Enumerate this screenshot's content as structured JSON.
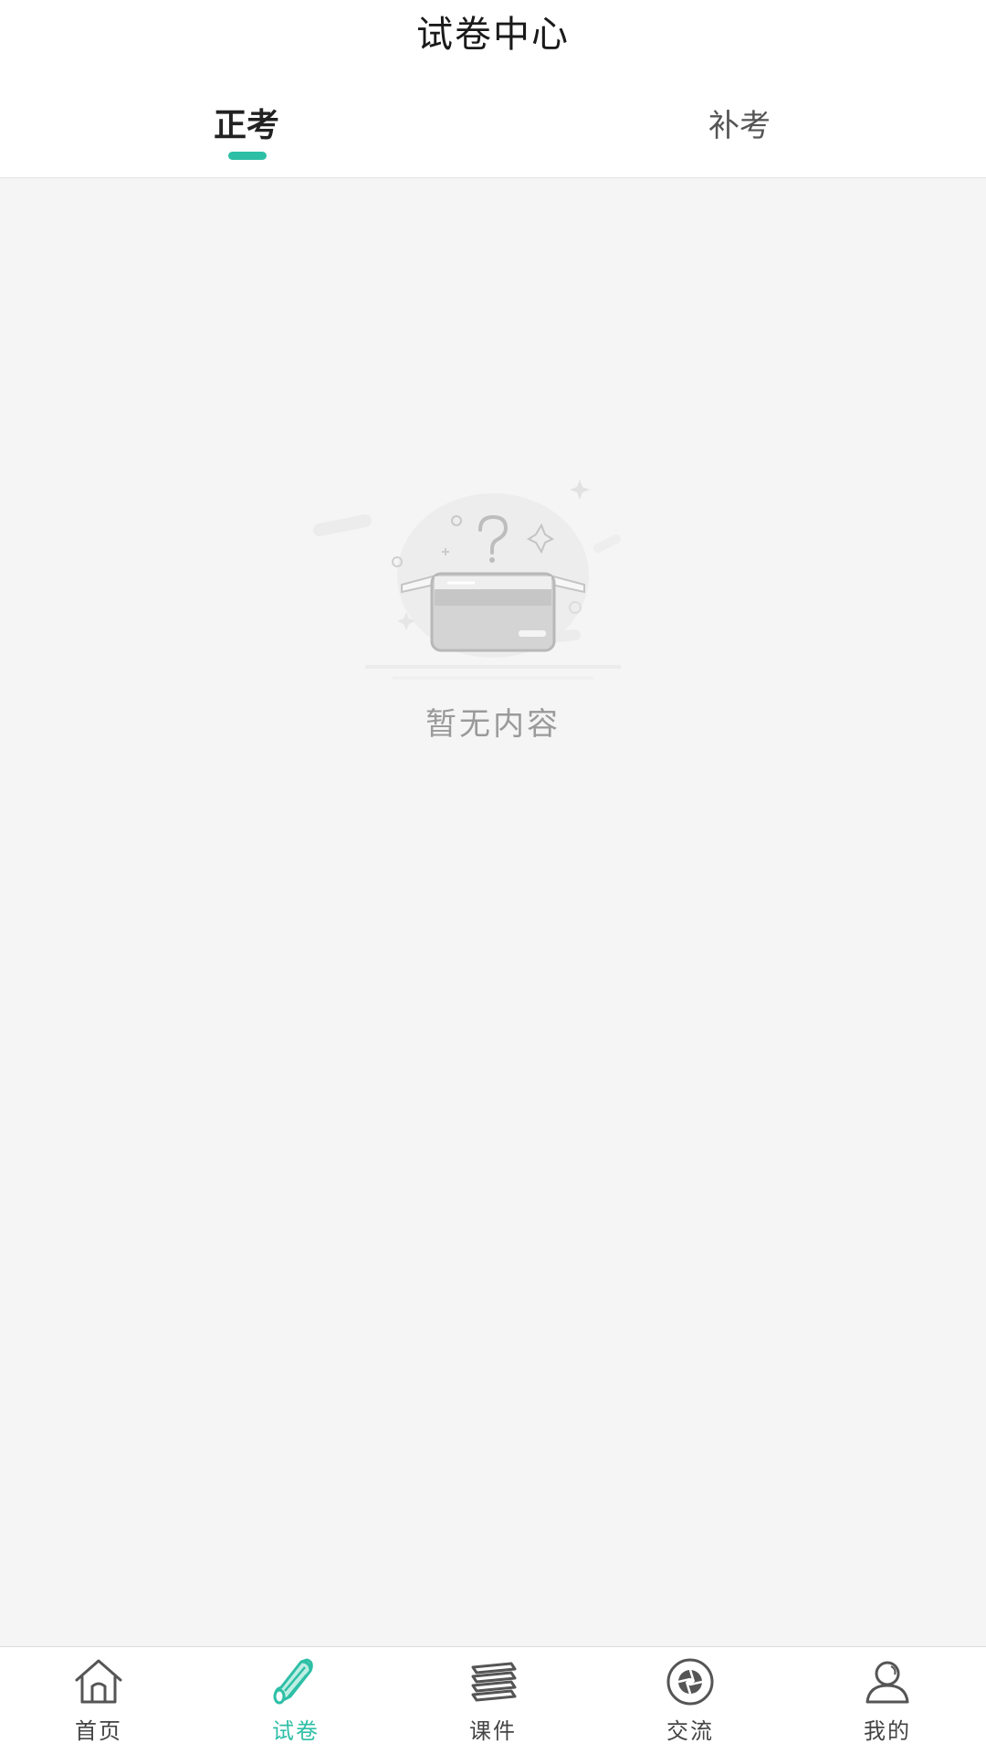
{
  "header": {
    "title": "试卷中心"
  },
  "tabs": [
    {
      "label": "正考",
      "active": true
    },
    {
      "label": "补考",
      "active": false
    }
  ],
  "empty_state": {
    "icon": "empty-box-icon",
    "text": "暂无内容"
  },
  "tabbar": {
    "items": [
      {
        "label": "首页",
        "icon": "home-icon",
        "active": false
      },
      {
        "label": "试卷",
        "icon": "exam-paper-icon",
        "active": true
      },
      {
        "label": "课件",
        "icon": "courseware-stack-icon",
        "active": false
      },
      {
        "label": "交流",
        "icon": "aperture-icon",
        "active": false
      },
      {
        "label": "我的",
        "icon": "user-icon",
        "active": false
      }
    ]
  },
  "colors": {
    "accent": "#2dbfa6",
    "background": "#f5f5f5",
    "header_bg": "#ffffff",
    "text_primary": "#222222",
    "text_muted": "#9a9a9a"
  }
}
